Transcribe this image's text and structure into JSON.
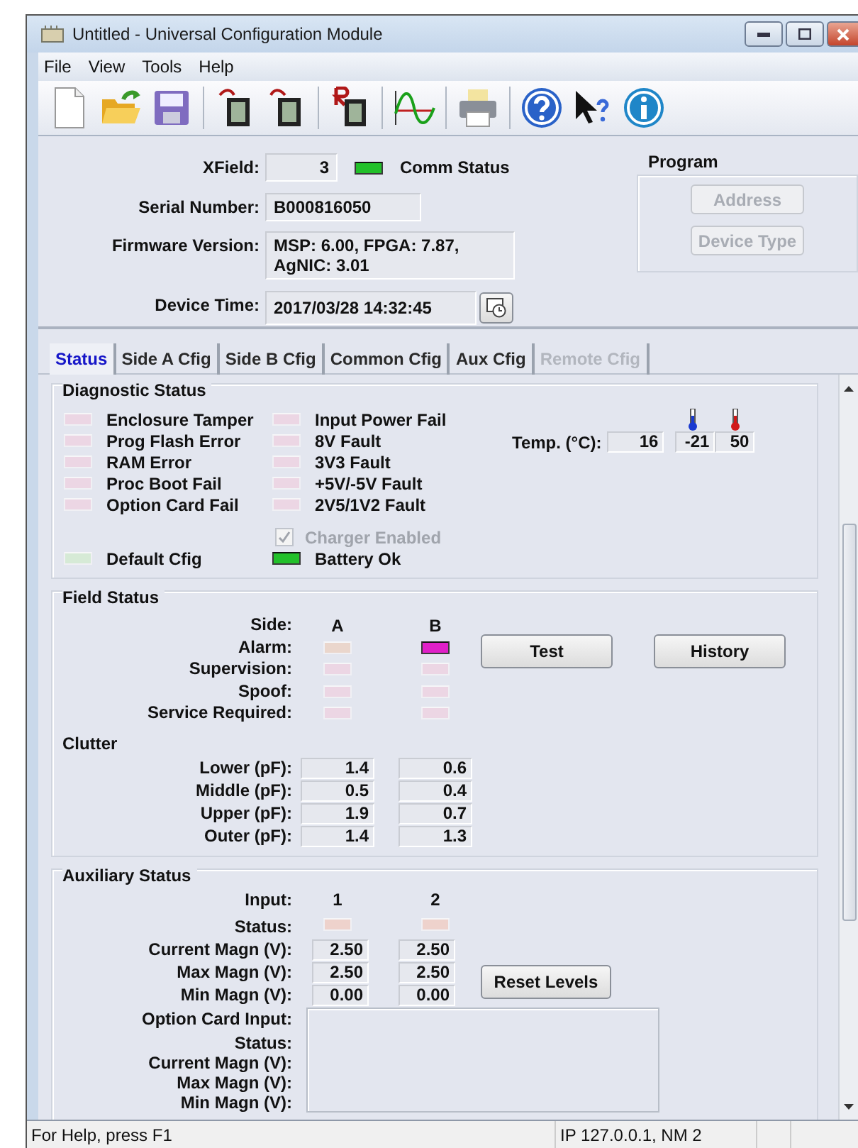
{
  "window": {
    "title": "Untitled - Universal Configuration Module"
  },
  "menu": [
    "File",
    "View",
    "Tools",
    "Help"
  ],
  "header": {
    "xfield": {
      "label": "XField:",
      "value": "3"
    },
    "comm_status": {
      "label": "Comm Status",
      "on": true,
      "color": "#22c02a"
    },
    "serial": {
      "label": "Serial Number:",
      "value": "B000816050"
    },
    "firmware": {
      "label": "Firmware Version:",
      "value": "MSP: 6.00, FPGA: 7.87, AgNIC: 3.01"
    },
    "device_time": {
      "label": "Device Time:",
      "value": "2017/03/28 14:32:45"
    }
  },
  "program": {
    "title": "Program",
    "buttons": [
      {
        "label": "Address",
        "disabled": true
      },
      {
        "label": "Device Type",
        "disabled": true
      }
    ]
  },
  "tabs": [
    {
      "label": "Status",
      "selected": true,
      "disabled": false
    },
    {
      "label": "Side A Cfig",
      "selected": false,
      "disabled": false
    },
    {
      "label": "Side B Cfig",
      "selected": false,
      "disabled": false
    },
    {
      "label": "Common Cfig",
      "selected": false,
      "disabled": false
    },
    {
      "label": "Aux Cfig",
      "selected": false,
      "disabled": false
    },
    {
      "label": "Remote Cfig",
      "selected": false,
      "disabled": true
    }
  ],
  "diagnostic": {
    "title": "Diagnostic Status",
    "columns": [
      [
        {
          "label": "Enclosure Tamper",
          "on": false,
          "color": "#ecd6e4"
        },
        {
          "label": "Prog Flash Error",
          "on": false,
          "color": "#ecd6e4"
        },
        {
          "label": "RAM Error",
          "on": false,
          "color": "#ecd6e4"
        },
        {
          "label": "Proc Boot Fail",
          "on": false,
          "color": "#ecd6e4"
        },
        {
          "label": "Option Card Fail",
          "on": false,
          "color": "#ecd6e4"
        }
      ],
      [
        {
          "label": "Input Power Fail",
          "on": false,
          "color": "#ecd6e4"
        },
        {
          "label": "8V Fault",
          "on": false,
          "color": "#ecd6e4"
        },
        {
          "label": "3V3 Fault",
          "on": false,
          "color": "#ecd6e4"
        },
        {
          "label": "+5V/-5V Fault",
          "on": false,
          "color": "#ecd6e4"
        },
        {
          "label": "2V5/1V2 Fault",
          "on": false,
          "color": "#ecd6e4"
        }
      ]
    ],
    "temperature": {
      "label": "Temp. (°C):",
      "values": [
        "16",
        "-21",
        "50"
      ]
    },
    "charger": {
      "label": "Charger Enabled",
      "checked": true,
      "disabled": true
    },
    "default_cfig": {
      "label": "Default Cfig",
      "on": false,
      "color": "#d6ead6"
    },
    "battery_ok": {
      "label": "Battery Ok",
      "on": true,
      "color": "#22c02a"
    }
  },
  "field_status": {
    "title": "Field Status",
    "side_label": "Side:",
    "sides": [
      "A",
      "B"
    ],
    "rows": [
      {
        "label": "Alarm:",
        "leds": [
          {
            "on": false,
            "color": "#ead6cc"
          },
          {
            "on": true,
            "color": "#e020c8"
          }
        ]
      },
      {
        "label": "Supervision:",
        "leds": [
          {
            "on": false,
            "color": "#ecd6e4"
          },
          {
            "on": false,
            "color": "#ecd6e4"
          }
        ]
      },
      {
        "label": "Spoof:",
        "leds": [
          {
            "on": false,
            "color": "#ecd6e4"
          },
          {
            "on": false,
            "color": "#ecd6e4"
          }
        ]
      },
      {
        "label": "Service Required:",
        "leds": [
          {
            "on": false,
            "color": "#ecd6e4"
          },
          {
            "on": false,
            "color": "#ecd6e4"
          }
        ]
      }
    ],
    "buttons": [
      "Test",
      "History"
    ],
    "clutter": {
      "title": "Clutter",
      "rows": [
        {
          "label": "Lower (pF):",
          "values": [
            "1.4",
            "0.6"
          ]
        },
        {
          "label": "Middle (pF):",
          "values": [
            "0.5",
            "0.4"
          ]
        },
        {
          "label": "Upper (pF):",
          "values": [
            "1.9",
            "0.7"
          ]
        },
        {
          "label": "Outer (pF):",
          "values": [
            "1.4",
            "1.3"
          ]
        }
      ]
    }
  },
  "auxiliary_status": {
    "title": "Auxiliary Status",
    "input_label": "Input:",
    "inputs": [
      "1",
      "2"
    ],
    "status": {
      "label": "Status:",
      "leds": [
        {
          "on": false,
          "color": "#eed2cc"
        },
        {
          "on": false,
          "color": "#eed2cc"
        }
      ]
    },
    "rows": [
      {
        "label": "Current Magn (V):",
        "values": [
          "2.50",
          "2.50"
        ]
      },
      {
        "label": "Max Magn (V):",
        "values": [
          "2.50",
          "2.50"
        ]
      },
      {
        "label": "Min Magn (V):",
        "values": [
          "0.00",
          "0.00"
        ]
      }
    ],
    "button": "Reset Levels",
    "option_card": [
      "Option Card Input:",
      "Status:",
      "Current Magn (V):",
      "Max Magn (V):",
      "Min Magn (V):"
    ]
  },
  "status_bar": [
    "For Help, press F1",
    "IP 127.0.0.1, NM 2"
  ]
}
